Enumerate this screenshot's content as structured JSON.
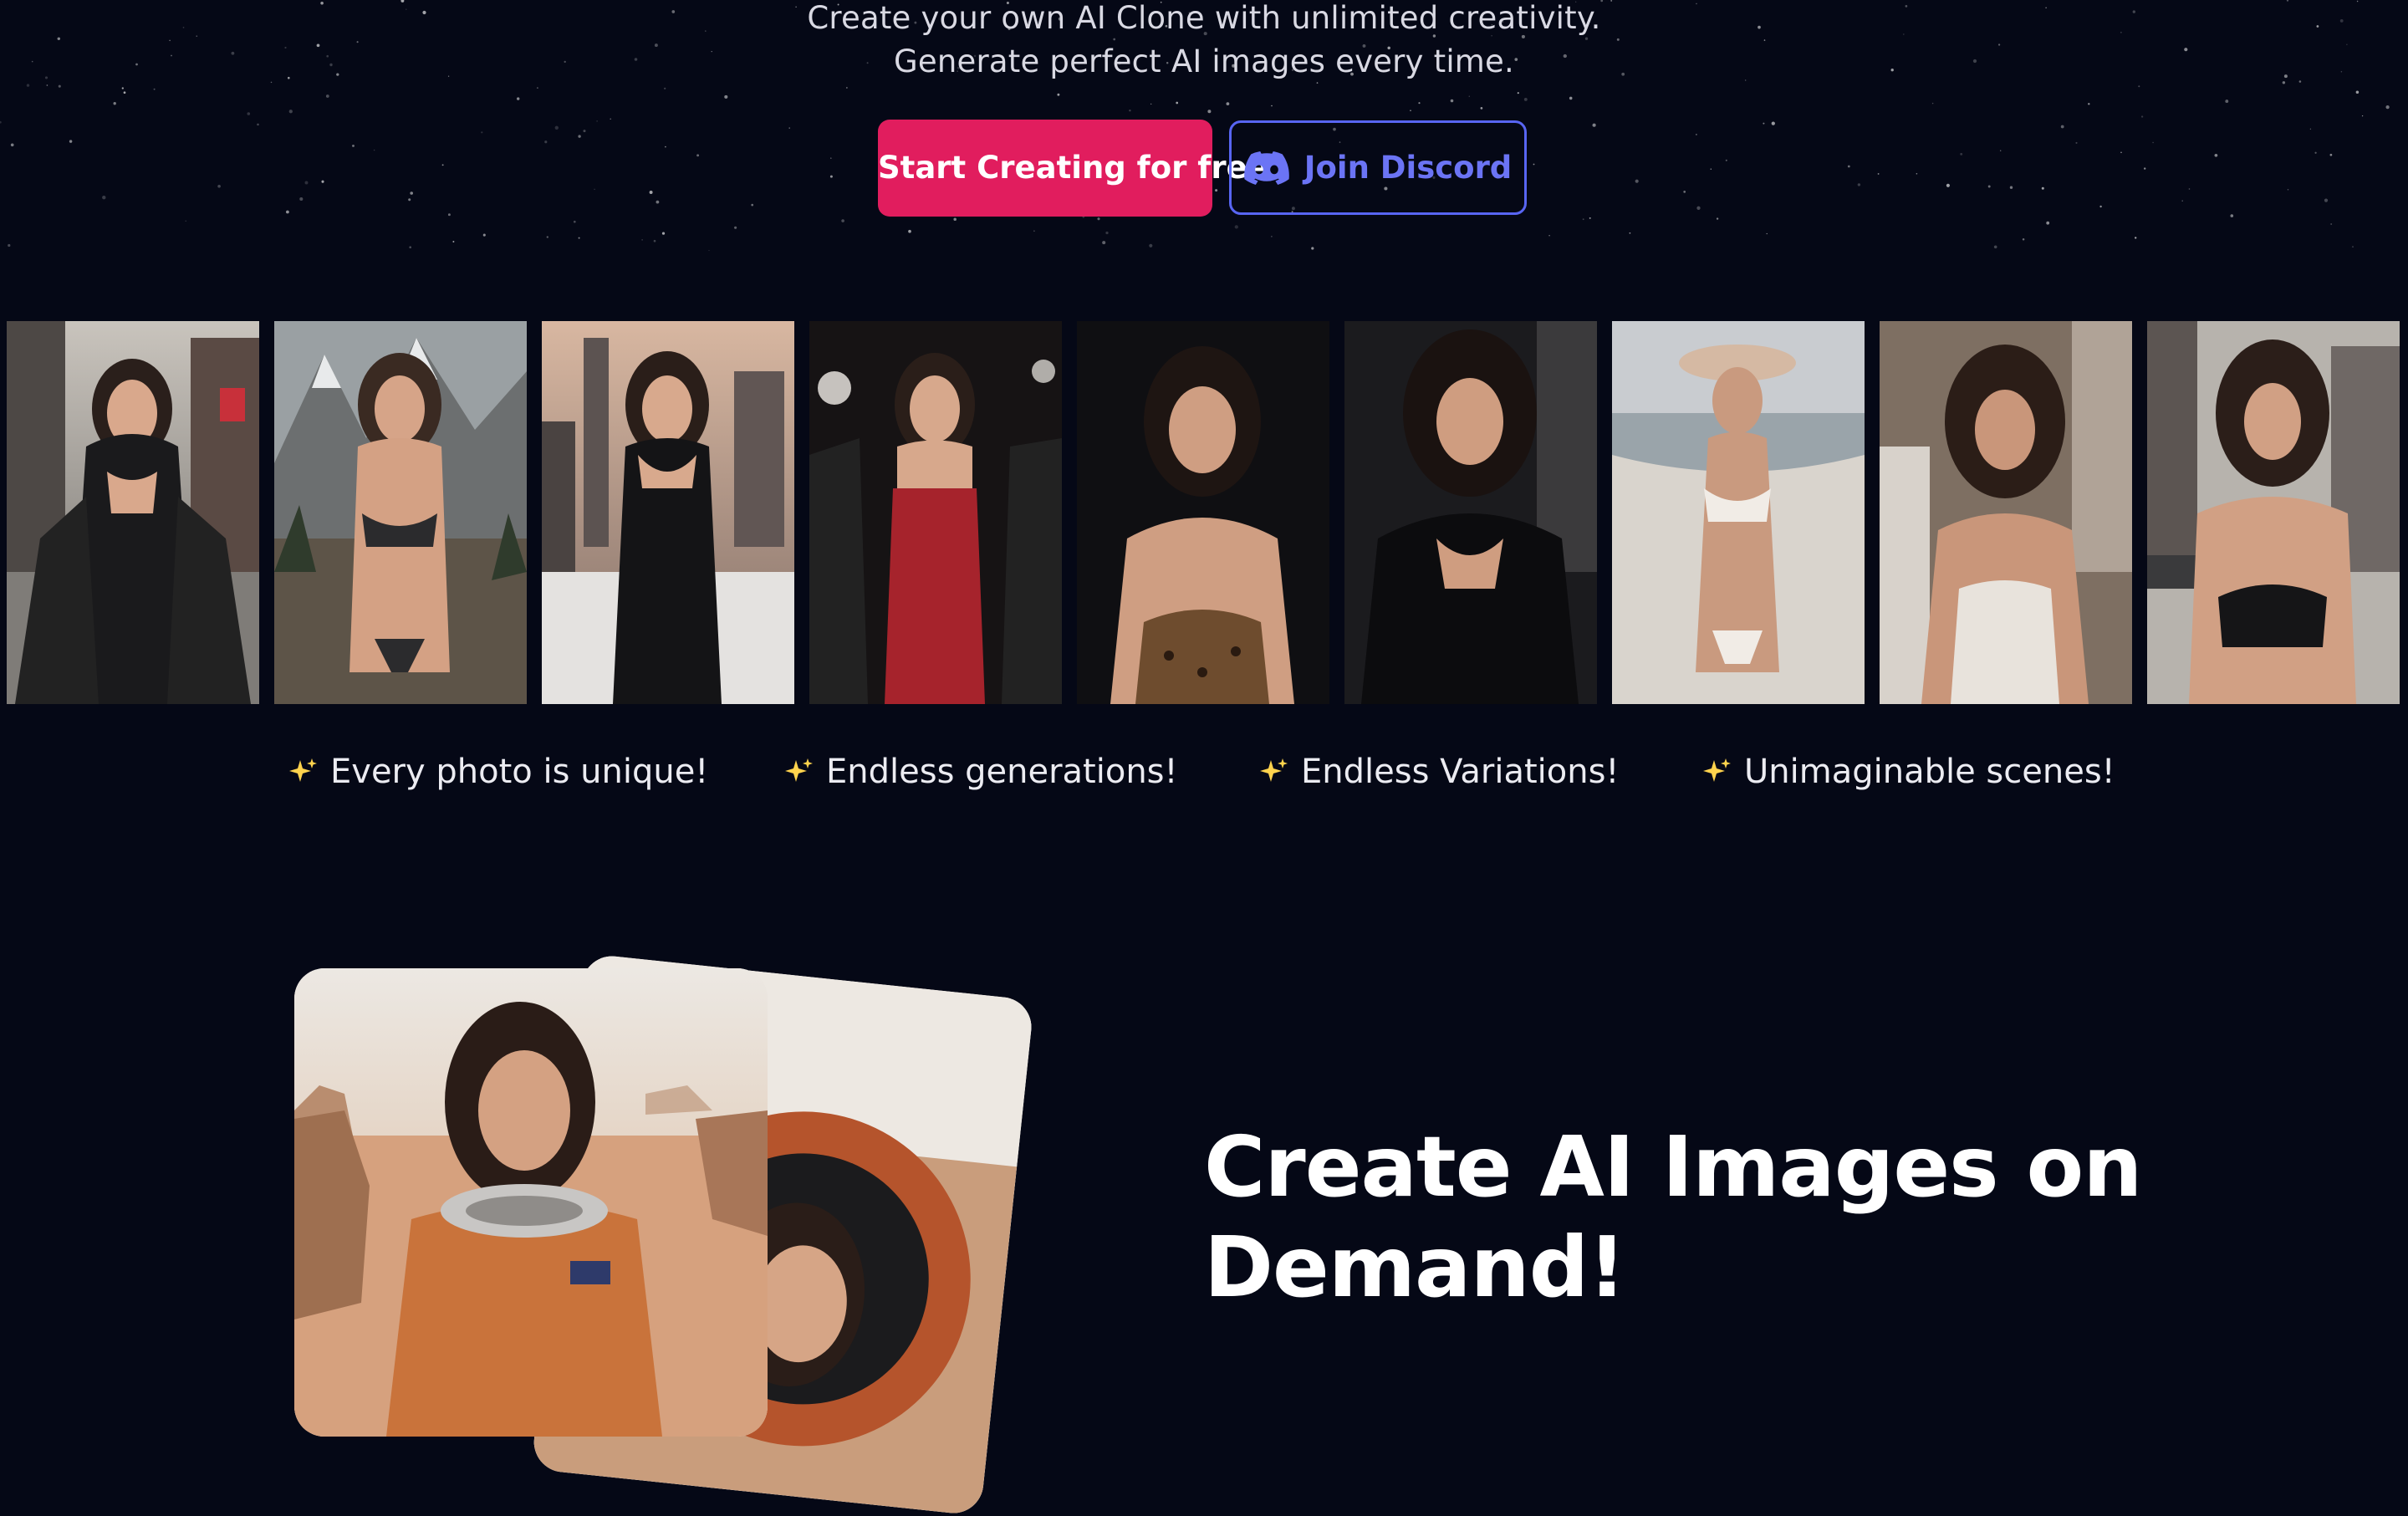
{
  "hero": {
    "tagline_1": "Create your own AI Clone with unlimited creativity.",
    "tagline_2": "Generate perfect AI images every time."
  },
  "cta": {
    "primary_label": "Start Creating for free",
    "discord_label": "Join Discord",
    "primary_color": "#e11d5e",
    "discord_color": "#5865f2"
  },
  "gallery": {
    "photos": [
      {
        "scene": "city-street",
        "outfit": "black dress and jacket"
      },
      {
        "scene": "mountains",
        "outfit": "black bikini"
      },
      {
        "scene": "city-rooftop",
        "outfit": "black slip dress"
      },
      {
        "scene": "red-carpet-night",
        "outfit": "red dress"
      },
      {
        "scene": "dark-studio",
        "outfit": "leopard top"
      },
      {
        "scene": "dark-room",
        "outfit": "black cutout top"
      },
      {
        "scene": "beach",
        "outfit": "white bikini and sun hat"
      },
      {
        "scene": "bedroom",
        "outfit": "white tank top"
      },
      {
        "scene": "city-street",
        "outfit": "black bikini top"
      }
    ]
  },
  "features": [
    {
      "icon": "sparkles-icon",
      "label": "Every photo is unique!"
    },
    {
      "icon": "sparkles-icon",
      "label": "Endless generations!"
    },
    {
      "icon": "sparkles-icon",
      "label": "Endless Variations!"
    },
    {
      "icon": "sparkles-icon",
      "label": "Unimaginable scenes!"
    }
  ],
  "section": {
    "headline_line_1": "Create AI Images on",
    "headline_line_2": "Demand!"
  }
}
